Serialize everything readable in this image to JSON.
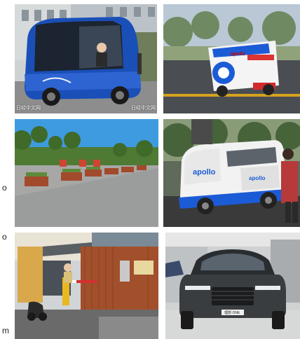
{
  "photos": [
    {
      "id": "minibus",
      "watermark_left": "日经中文网",
      "watermark_right": "日经中文网"
    },
    {
      "id": "delivery-robot",
      "vehicle_brand": "apollo"
    },
    {
      "id": "park",
      "watermark": ""
    },
    {
      "id": "van-apollo",
      "vehicle_brand": "apollo",
      "vehicle_brand_2": "apollo"
    },
    {
      "id": "parking-booth"
    },
    {
      "id": "suv",
      "plate": "理想 ONE"
    }
  ],
  "margin_marks": [
    "o",
    "o",
    "m"
  ]
}
